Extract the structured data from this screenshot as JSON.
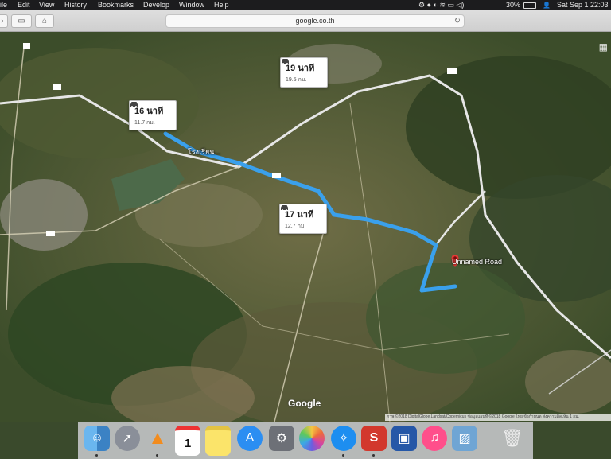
{
  "menubar": {
    "items": [
      "ile",
      "Edit",
      "View",
      "History",
      "Bookmarks",
      "Develop",
      "Window",
      "Help"
    ],
    "battery": "30%",
    "clock": "Sat Sep 1  22:03"
  },
  "browser": {
    "url": "google.co.th"
  },
  "map": {
    "routes": [
      {
        "time": "16 นาที",
        "distance": "11.7 กม."
      },
      {
        "time": "19 นาที",
        "distance": "19.5 กม."
      },
      {
        "time": "17 นาที",
        "distance": "12.7 กม."
      }
    ],
    "place_label": "โรงเรียน...",
    "destination_label": "Unnamed Road",
    "logo": "Google",
    "attribution": "ภาพ ©2018 DigitalGlobe,Landsat/Copernicus ข้อมูลแผนที่ ©2018 Google  ไทย  ข้อกำหนด  ส่งความคิดเห็น  1 กม.",
    "route_color": "#3aa0ec"
  },
  "dock": {
    "items": [
      {
        "name": "finder-icon"
      },
      {
        "name": "launchpad-icon"
      },
      {
        "name": "vlc-icon"
      },
      {
        "name": "calendar-icon",
        "text": "1"
      },
      {
        "name": "notes-icon"
      },
      {
        "name": "app-store-icon"
      },
      {
        "name": "system-preferences-icon"
      },
      {
        "name": "photos-icon"
      },
      {
        "name": "safari-icon"
      },
      {
        "name": "app-icon-red"
      },
      {
        "name": "app-icon-blue"
      },
      {
        "name": "itunes-icon"
      },
      {
        "name": "preview-icon"
      },
      {
        "name": "trash-icon"
      }
    ]
  }
}
